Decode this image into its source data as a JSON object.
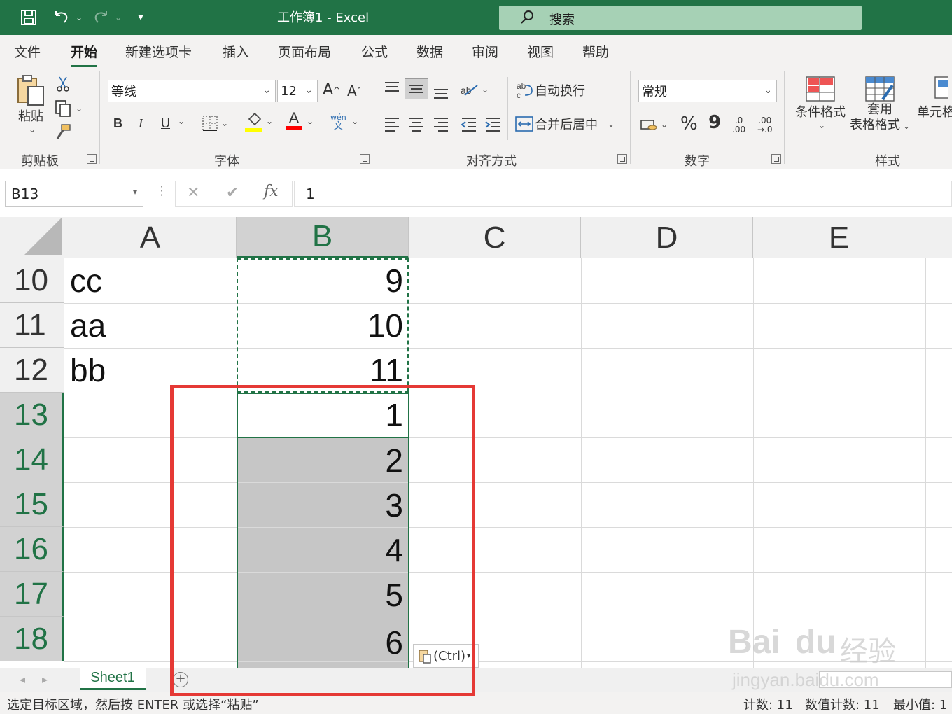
{
  "titlebar": {
    "title": "工作簿1  -  Excel",
    "search_label": "搜索"
  },
  "menu": {
    "tabs": [
      "文件",
      "开始",
      "新建选项卡",
      "插入",
      "页面布局",
      "公式",
      "数据",
      "审阅",
      "视图",
      "帮助"
    ],
    "active": "开始"
  },
  "ribbon": {
    "clipboard": {
      "paste": "粘贴",
      "label": "剪贴板"
    },
    "font": {
      "name": "等线",
      "size": "12",
      "grow": "A",
      "shrink": "A",
      "bold": "B",
      "italic": "I",
      "underline": "U",
      "phonetic_top": "wén",
      "phonetic_bottom": "文",
      "color_letter": "A",
      "label": "字体"
    },
    "alignment": {
      "wrap": "自动换行",
      "merge": "合并后居中",
      "label": "对齐方式"
    },
    "number": {
      "format": "常规",
      "percent": "%",
      "comma": "9",
      "inc_top": ".0",
      "inc_bottom": ".00",
      "dec_top": ".00",
      "dec_bottom": "→.0",
      "label": "数字"
    },
    "styles": {
      "conditional": "条件格式",
      "table_top": "套用",
      "table_bottom": "表格格式",
      "cell_styles": "单元格",
      "label": "样式"
    },
    "colors": {
      "accent": "#217346",
      "highlight": "#ffff00",
      "font_color": "#ff0000"
    }
  },
  "formula_bar": {
    "name_box": "B13",
    "cancel": "✕",
    "enter": "✔",
    "fx": "fx",
    "value": "1"
  },
  "grid": {
    "columns": [
      "A",
      "B",
      "C",
      "D",
      "E"
    ],
    "rows": [
      {
        "num": "10",
        "a": "cc",
        "b": "9"
      },
      {
        "num": "11",
        "a": "aa",
        "b": "10"
      },
      {
        "num": "12",
        "a": "bb",
        "b": "11"
      },
      {
        "num": "13",
        "a": "",
        "b": "1"
      },
      {
        "num": "14",
        "a": "",
        "b": "2"
      },
      {
        "num": "15",
        "a": "",
        "b": "3"
      },
      {
        "num": "16",
        "a": "",
        "b": "4"
      },
      {
        "num": "17",
        "a": "",
        "b": "5"
      },
      {
        "num": "18",
        "a": "",
        "b": "6"
      }
    ],
    "paste_options": "(Ctrl)"
  },
  "sheets": {
    "tabs": [
      "Sheet1"
    ],
    "add": "+"
  },
  "status": {
    "message": "选定目标区域，然后按 ENTER 或选择“粘贴”",
    "count": "计数: 11",
    "numeric_count": "数值计数: 11",
    "min": "最小值: 1"
  },
  "watermark": {
    "line1": "Bai",
    "line2": "du",
    "line3": "经验",
    "url": "jingyan.baidu.com"
  }
}
